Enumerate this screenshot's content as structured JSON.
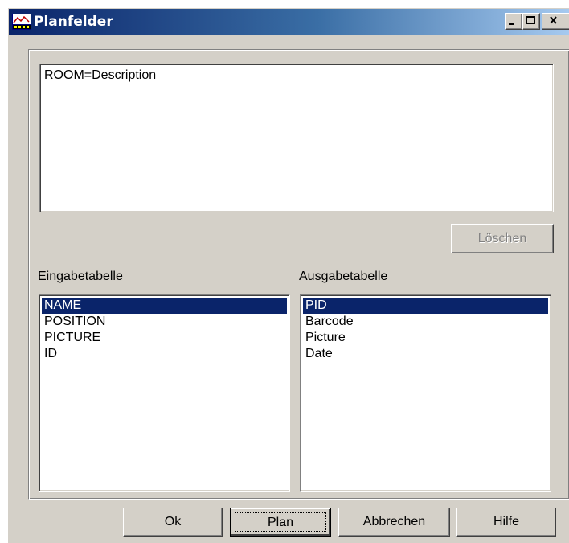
{
  "window": {
    "title": "Planfelder",
    "app_icon": "planfelder-app-icon"
  },
  "controls": {
    "minimize_glyph": "_",
    "maximize_glyph": "□",
    "close_glyph": "x"
  },
  "mapping_text": "ROOM=Description",
  "buttons": {
    "delete": "Löschen",
    "ok": "Ok",
    "plan": "Plan",
    "cancel": "Abbrechen",
    "help": "Hilfe"
  },
  "input_table": {
    "label": "Eingabetabelle",
    "items": [
      "NAME",
      "POSITION",
      "PICTURE",
      "ID"
    ],
    "selected": "NAME"
  },
  "output_table": {
    "label": "Ausgabetabelle",
    "items": [
      "PID",
      "Barcode",
      "Picture",
      "Date"
    ],
    "selected": "PID"
  },
  "colors": {
    "titlebar_start": "#0a246a",
    "titlebar_end": "#a6caf0",
    "selection": "#0a246a",
    "face": "#d4d0c8"
  }
}
